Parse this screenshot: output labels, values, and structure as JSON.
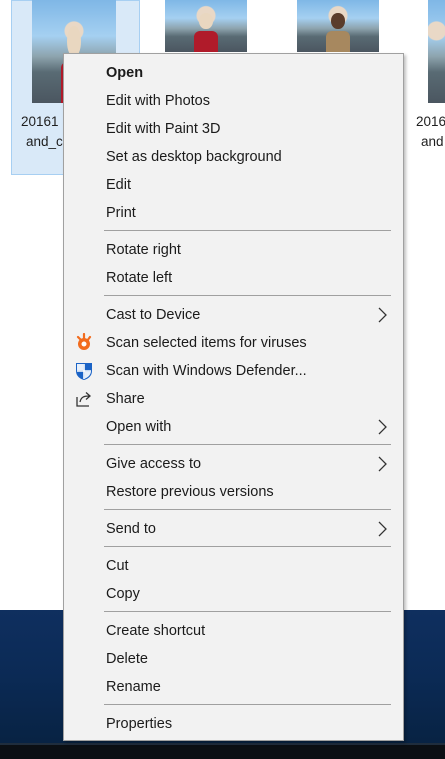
{
  "desktop": {
    "thumbnails": [
      {
        "label_line1": "20161",
        "label_line2": "and_c"
      },
      {
        "label_line1": "",
        "label_line2": ""
      },
      {
        "label_line1": "",
        "label_line2": ""
      },
      {
        "label_line1": "2016",
        "label_line2": "and"
      }
    ]
  },
  "context_menu": {
    "items": [
      {
        "label": "Open",
        "bold": true
      },
      {
        "label": "Edit with Photos"
      },
      {
        "label": "Edit with Paint 3D"
      },
      {
        "label": "Set as desktop background"
      },
      {
        "label": "Edit"
      },
      {
        "label": "Print"
      },
      {
        "label": "Rotate right"
      },
      {
        "label": "Rotate left"
      },
      {
        "label": "Cast to Device",
        "submenu": true
      },
      {
        "label": "Scan selected items for viruses",
        "icon": "avast-icon"
      },
      {
        "label": "Scan with Windows Defender...",
        "icon": "windows-defender-icon"
      },
      {
        "label": "Share",
        "icon": "share-icon"
      },
      {
        "label": "Open with",
        "submenu": true
      },
      {
        "label": "Give access to",
        "submenu": true
      },
      {
        "label": "Restore previous versions"
      },
      {
        "label": "Send to",
        "submenu": true
      },
      {
        "label": "Cut"
      },
      {
        "label": "Copy"
      },
      {
        "label": "Create shortcut"
      },
      {
        "label": "Delete"
      },
      {
        "label": "Rename"
      },
      {
        "label": "Properties"
      }
    ]
  },
  "colors": {
    "menu_bg": "#f2f2f2",
    "menu_border": "#a0a0a0",
    "selection_bg": "#d9e9f8",
    "avast_orange": "#f26c1e",
    "defender_blue": "#1b63c6",
    "desktop_blue": "#0b2a55"
  }
}
